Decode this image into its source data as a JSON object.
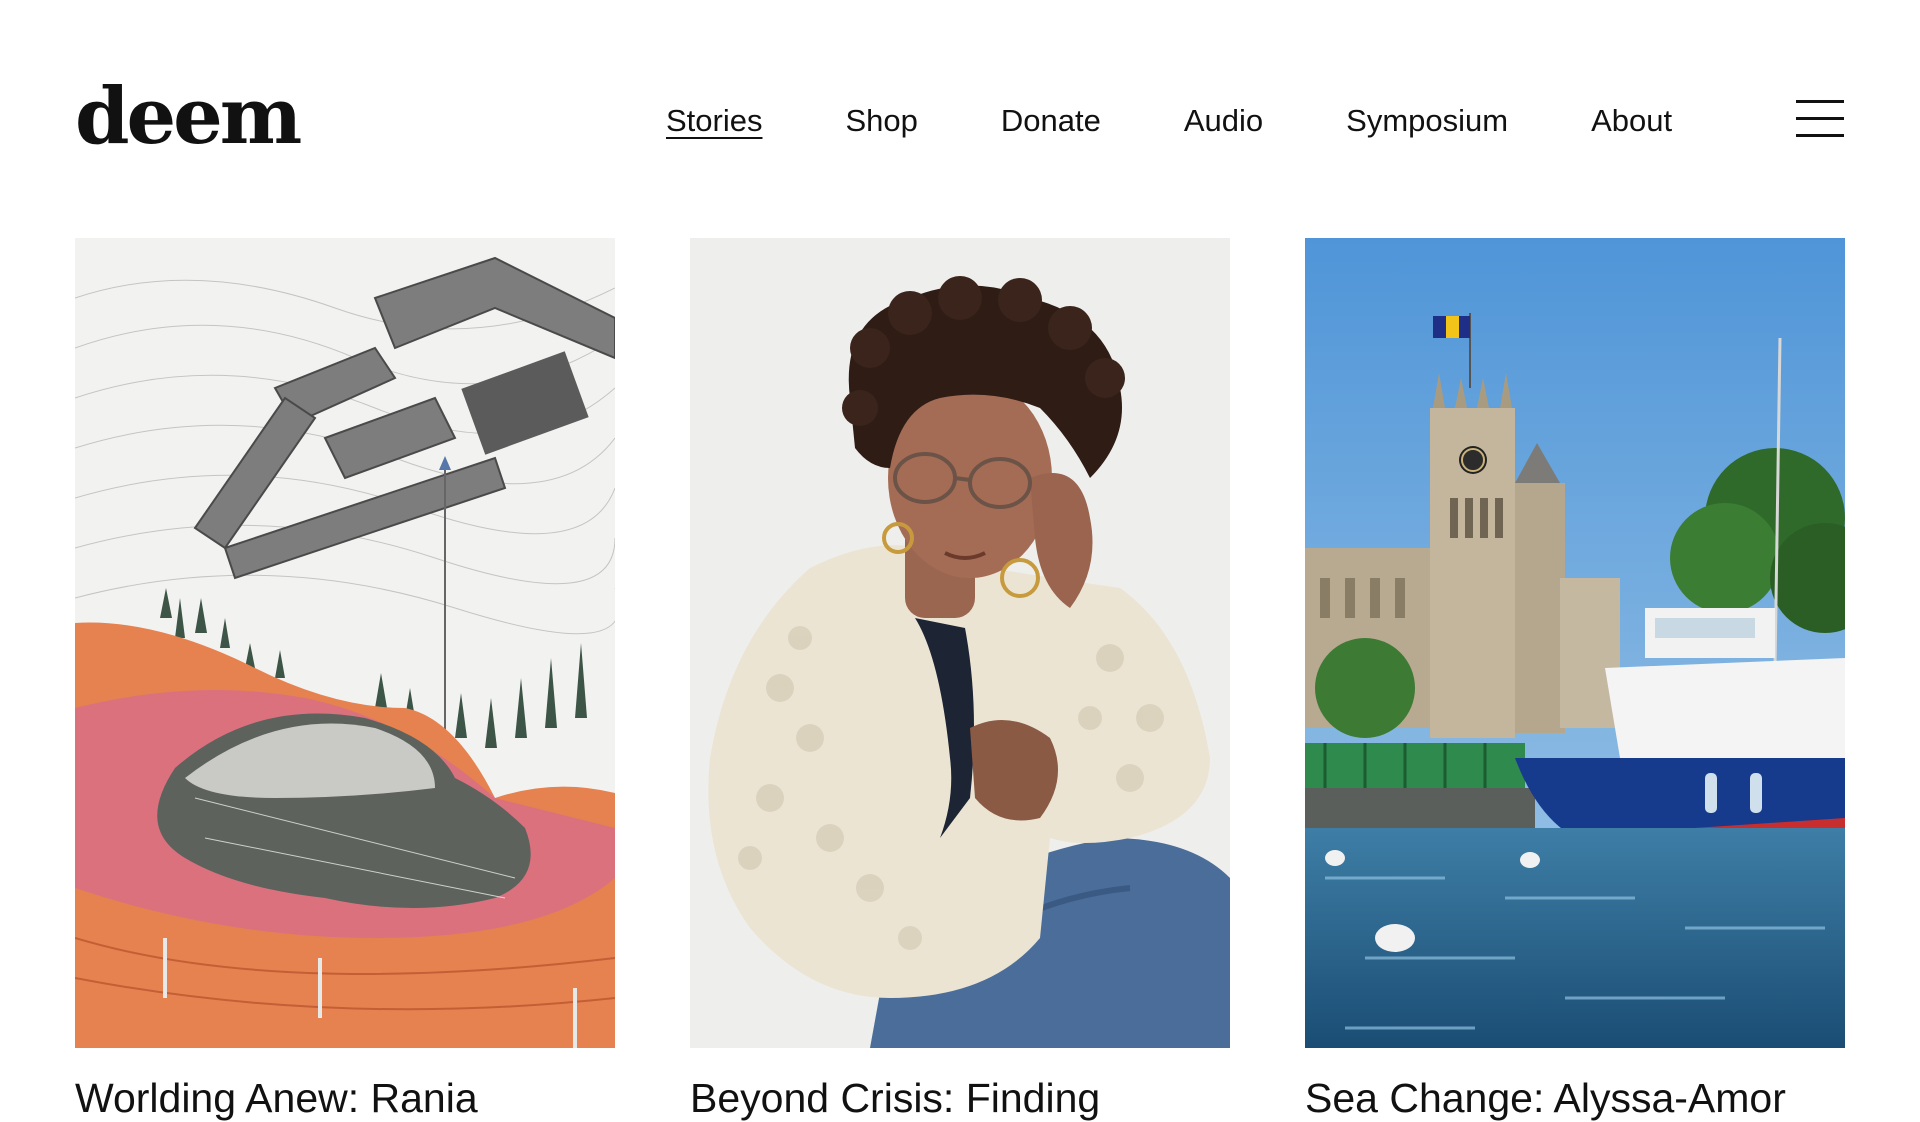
{
  "header": {
    "logo": "deem",
    "nav": [
      {
        "label": "Stories",
        "active": true
      },
      {
        "label": "Shop",
        "active": false
      },
      {
        "label": "Donate",
        "active": false
      },
      {
        "label": "Audio",
        "active": false
      },
      {
        "label": "Symposium",
        "active": false
      },
      {
        "label": "About",
        "active": false
      }
    ],
    "menu_icon": "hamburger-menu-icon"
  },
  "stories": [
    {
      "title": "Worlding Anew: Rania",
      "image": "architectural-landscape-illustration"
    },
    {
      "title": "Beyond Crisis: Finding",
      "image": "portrait-woman-cream-sweater"
    },
    {
      "title": "Sea Change: Alyssa-Amor",
      "image": "harbor-clocktower-boat-photo"
    }
  ],
  "colors": {
    "text": "#111111",
    "background": "#ffffff"
  }
}
